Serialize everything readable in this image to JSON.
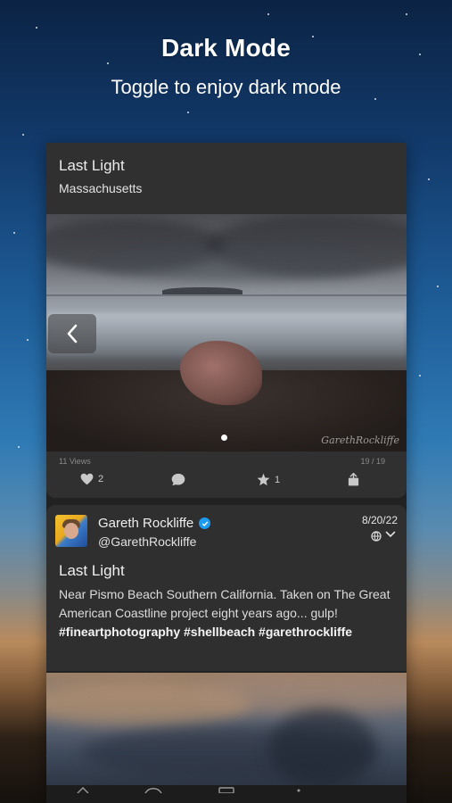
{
  "header": {
    "title": "Dark Mode",
    "subtitle": "Toggle to enjoy dark mode"
  },
  "card1": {
    "title": "Last Light",
    "location": "Massachusetts",
    "photo_signature": "GarethRockliffe",
    "views": "11 Views",
    "pager": "19 / 19",
    "likes": "2",
    "stars": "1"
  },
  "post": {
    "user_name": "Gareth Rockliffe",
    "handle": "@GarethRockliffe",
    "date": "8/20/22",
    "title": "Last Light",
    "body_text": "Near Pismo Beach Southern California. Taken on The Great American Coastline project eight years ago... gulp! ",
    "hashtags": "#fineartphotography #shellbeach #garethrockliffe"
  },
  "colors": {
    "card_bg": "#303030",
    "verified": "#1d9bf0",
    "text_primary": "#efefef"
  },
  "icons": [
    "chevron-left-icon",
    "heart-icon",
    "comment-icon",
    "star-icon",
    "share-icon",
    "verified-icon",
    "globe-icon",
    "chevron-down-icon"
  ]
}
